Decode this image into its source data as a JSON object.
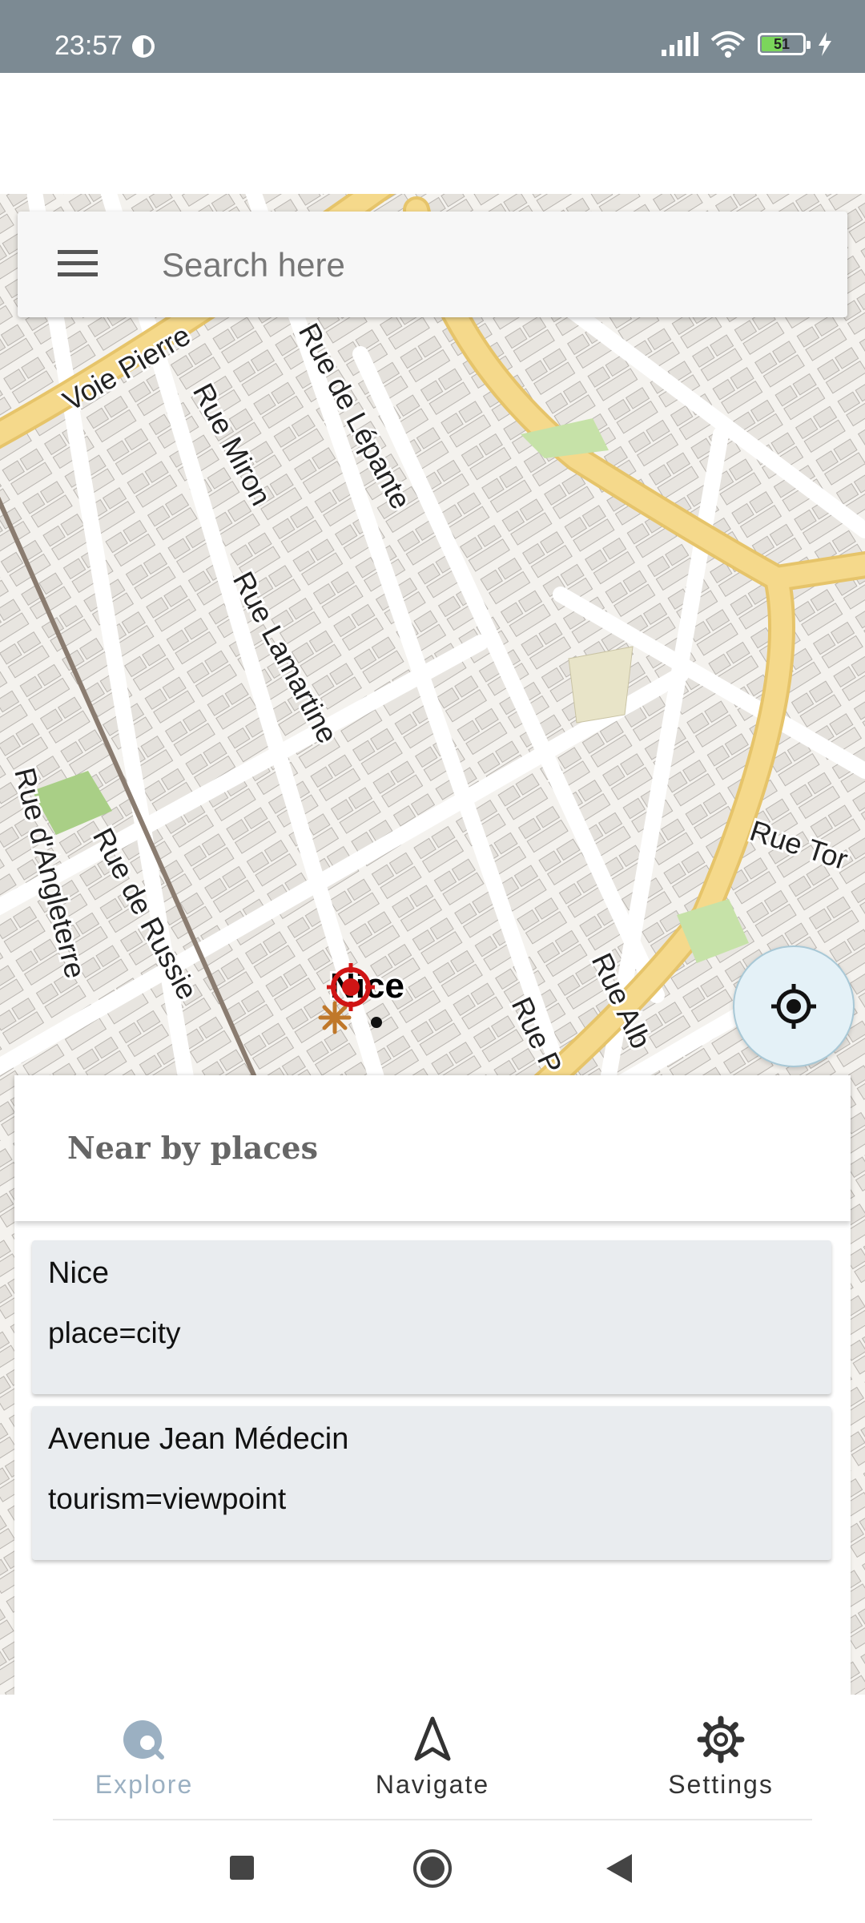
{
  "status_bar": {
    "time": "23:57",
    "battery_level": "51",
    "battery_fraction": 0.51
  },
  "search": {
    "placeholder": "Search here"
  },
  "map": {
    "street_labels": [
      "Voie Pierre",
      "Rue de Lépante",
      "Rue Miron",
      "Rue Lamartine",
      "Rue d'Angleterre",
      "Rue de Russie",
      "Rue Tor",
      "Rue Alb",
      "Rue P",
      "Nice"
    ]
  },
  "nearby": {
    "title": "Near by places",
    "items": [
      {
        "name": "Nice",
        "tag": "place=city"
      },
      {
        "name": "Avenue Jean Médecin",
        "tag": "tourism=viewpoint"
      }
    ]
  },
  "bottom_nav": {
    "items": [
      {
        "label": "Explore",
        "icon": "explore-icon",
        "active": true
      },
      {
        "label": "Navigate",
        "icon": "navigate-icon",
        "active": false
      },
      {
        "label": "Settings",
        "icon": "gear-icon",
        "active": false
      }
    ]
  },
  "colors": {
    "status_bar": "#7c8a93",
    "active_nav": "#9bb0c2",
    "inactive_nav": "#333333",
    "major_road": "#f4d27d",
    "card_bg": "#e9ecef"
  }
}
